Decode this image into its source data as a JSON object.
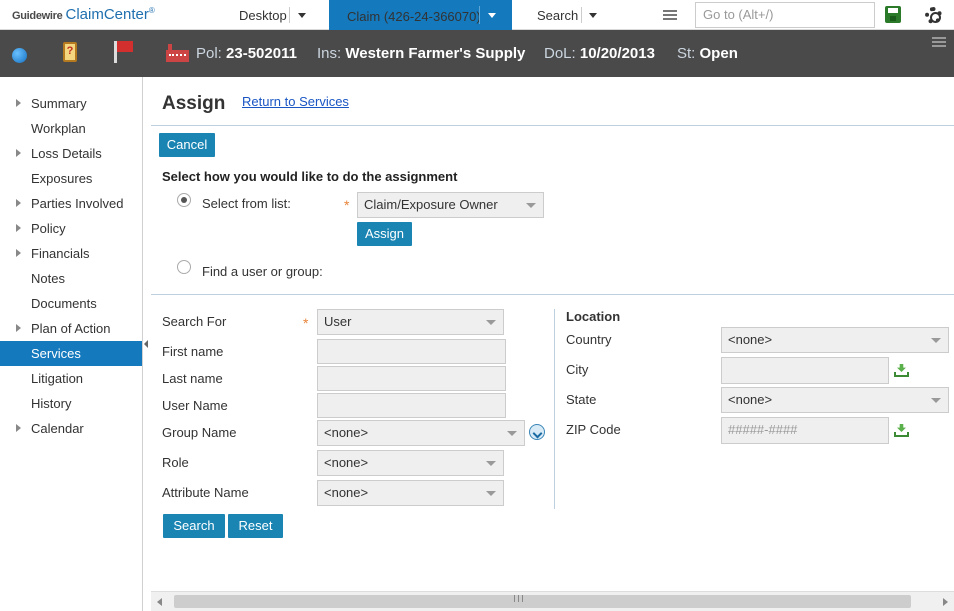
{
  "topbar": {
    "logo_brand": "Guidewire",
    "logo_product": "ClaimCenter",
    "logo_mark": "®",
    "tab_desktop": "Desktop",
    "tab_claim": "Claim (426-24-366070)",
    "tab_search": "Search",
    "goto_placeholder": "Go to (Alt+/)",
    "icons": [
      "menu-icon",
      "save-icon",
      "gear-icon"
    ]
  },
  "infobar": {
    "policy_key": "Pol:",
    "policy_value": "23-502011",
    "insured_key": "Ins:",
    "insured_value": "Western Farmer's Supply",
    "dol_key": "DoL:",
    "dol_value": "10/20/2013",
    "status_key": "St:",
    "status_value": "Open",
    "clipboard_glyph": "?",
    "icons": [
      "globe-icon",
      "clipboard-icon",
      "flag-icon",
      "factory-icon",
      "menu-icon"
    ]
  },
  "sidebar": {
    "items": [
      {
        "label": "Summary",
        "expandable": true
      },
      {
        "label": "Workplan",
        "expandable": false
      },
      {
        "label": "Loss Details",
        "expandable": true
      },
      {
        "label": "Exposures",
        "expandable": false
      },
      {
        "label": "Parties Involved",
        "expandable": true
      },
      {
        "label": "Policy",
        "expandable": true
      },
      {
        "label": "Financials",
        "expandable": true
      },
      {
        "label": "Notes",
        "expandable": false
      },
      {
        "label": "Documents",
        "expandable": false
      },
      {
        "label": "Plan of Action",
        "expandable": true
      },
      {
        "label": "Services",
        "expandable": false,
        "active": true
      },
      {
        "label": "Litigation",
        "expandable": false
      },
      {
        "label": "History",
        "expandable": false
      },
      {
        "label": "Calendar",
        "expandable": true
      }
    ]
  },
  "main": {
    "title": "Assign",
    "return_link": "Return to Services",
    "cancel_button": "Cancel",
    "section_title": "Select how you would like to do the assignment",
    "option_list_label": "Select from list:",
    "option_list_selected": true,
    "assign_select_value": "Claim/Exposure Owner",
    "assign_button": "Assign",
    "option_find_label": "Find a user or group:",
    "option_find_selected": false,
    "required_mark": "*",
    "search": {
      "search_for_label": "Search For",
      "search_for_value": "User",
      "first_name_label": "First name",
      "first_name_value": "",
      "last_name_label": "Last name",
      "last_name_value": "",
      "user_name_label": "User Name",
      "user_name_value": "",
      "group_name_label": "Group Name",
      "group_name_value": "<none>",
      "role_label": "Role",
      "role_value": "<none>",
      "attribute_label": "Attribute Name",
      "attribute_value": "<none>",
      "search_button": "Search",
      "reset_button": "Reset"
    },
    "location": {
      "heading": "Location",
      "country_label": "Country",
      "country_value": "<none>",
      "city_label": "City",
      "city_value": "",
      "state_label": "State",
      "state_value": "<none>",
      "zip_label": "ZIP Code",
      "zip_placeholder": "#####-####"
    }
  },
  "colors": {
    "accent_blue": "#1479bd",
    "button_blue": "#1a84b3",
    "infobar_bg": "#4a4a4a",
    "required_orange": "#e8843a",
    "link_blue": "#1a55c4"
  }
}
